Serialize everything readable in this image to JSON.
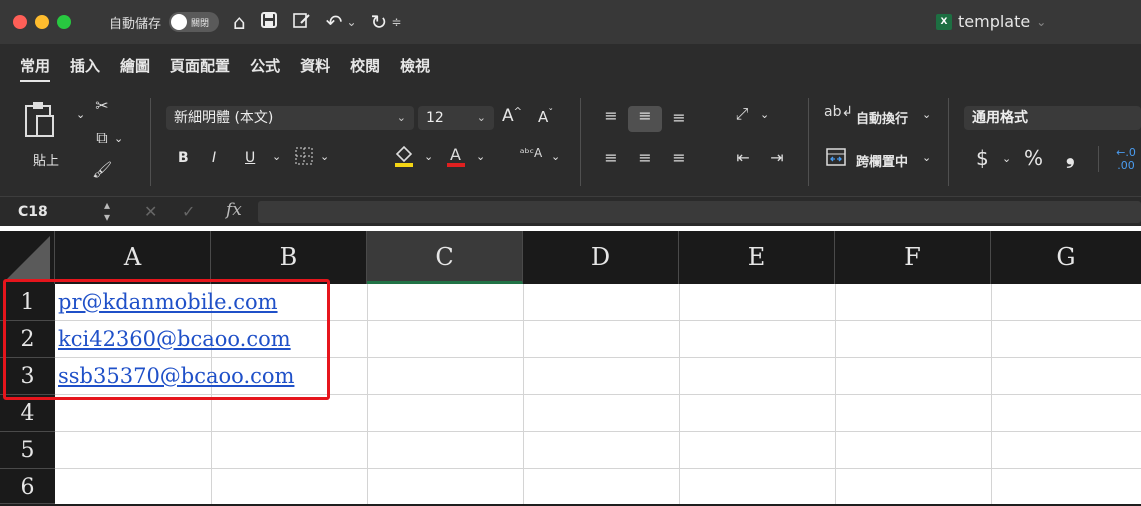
{
  "titlebar": {
    "autosave_label": "自動儲存",
    "autosave_toggle": "關閉",
    "document_title": "template",
    "xl_icon_text": "X"
  },
  "tabs": [
    {
      "label": "常用"
    },
    {
      "label": "插入"
    },
    {
      "label": "繪圖"
    },
    {
      "label": "頁面配置"
    },
    {
      "label": "公式"
    },
    {
      "label": "資料"
    },
    {
      "label": "校閱"
    },
    {
      "label": "檢視"
    }
  ],
  "ribbon": {
    "paste_label": "貼上",
    "font_name": "新細明體 (本文)",
    "font_size": "12",
    "grow_font": "A^",
    "shrink_font": "Aˇ",
    "bold": "B",
    "italic": "I",
    "underline": "U",
    "wrap_text": "自動換行",
    "merge_center": "跨欄置中",
    "number_format": "通用格式",
    "currency": "$",
    "percent": "%",
    "comma": "❟"
  },
  "formula_bar": {
    "name_box": "C18",
    "fx": "fx",
    "value": ""
  },
  "sheet": {
    "columns": [
      "A",
      "B",
      "C",
      "D",
      "E",
      "F",
      "G"
    ],
    "selected_column": "C",
    "rows": [
      "1",
      "2",
      "3",
      "4",
      "5",
      "6"
    ],
    "cells": [
      {
        "ref": "A1",
        "value": "pr@kdanmobile.com"
      },
      {
        "ref": "A2",
        "value": "kci42360@bcaoo.com"
      },
      {
        "ref": "A3",
        "value": "ssb35370@bcaoo.com"
      }
    ]
  },
  "colors": {
    "highlight_box": "#e6151c",
    "link": "#1f50c8",
    "selected_column_accent": "#217346"
  }
}
